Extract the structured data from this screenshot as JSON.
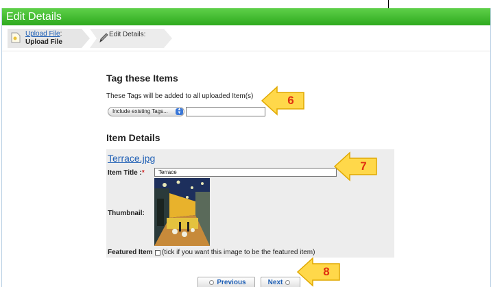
{
  "window": {
    "title": "Edit Details"
  },
  "wizard": {
    "step1": {
      "link": "Upload File",
      "suffix": ":",
      "label": "Upload File"
    },
    "step2": {
      "label": "Edit Details:"
    }
  },
  "tags": {
    "heading": "Tag these Items",
    "description": "These Tags will be added to all uploaded Item(s)",
    "select_value": "Include existing Tags...",
    "input_value": ""
  },
  "details": {
    "heading": "Item Details",
    "file_name": "Terrace.jpg",
    "title_label": "Item Title :",
    "required_mark": "*",
    "title_value": "Terrace",
    "thumbnail_label": "Thumbnail:",
    "featured_label": "Featured Item",
    "featured_hint": "(tick if you want this image to be the featured item)"
  },
  "buttons": {
    "previous": "Previous",
    "next": "Next"
  },
  "callouts": {
    "c6": "6",
    "c7": "7",
    "c8": "8"
  },
  "colors": {
    "titlebar": "#3dbb2a",
    "link": "#1e5fb5",
    "callout_fill": "#ffd84a",
    "callout_text": "#e03010"
  }
}
